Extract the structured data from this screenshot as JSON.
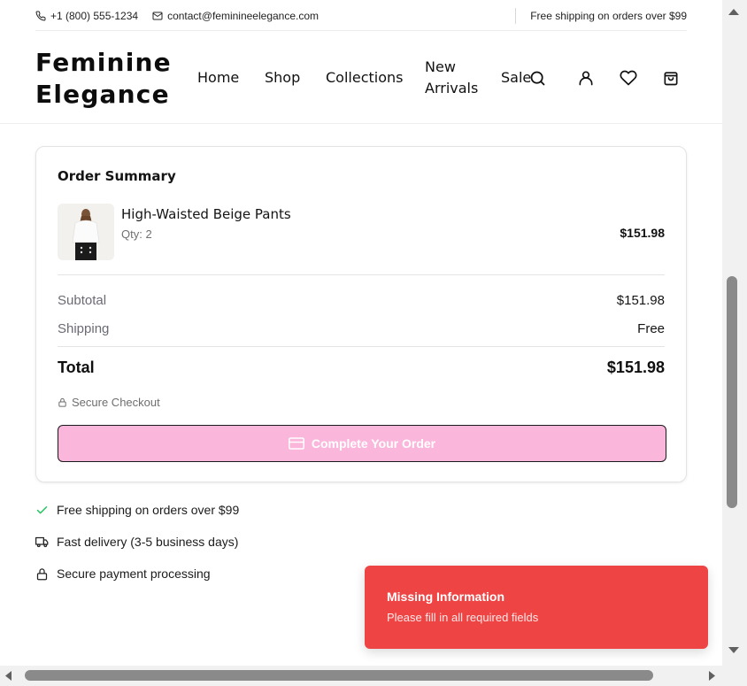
{
  "topbar": {
    "phone": "+1 (800) 555-1234",
    "email": "contact@feminineelegance.com",
    "promo": "Free shipping on orders over $99"
  },
  "header": {
    "logo_line1": "Feminine",
    "logo_line2": "Elegance",
    "nav": {
      "home": "Home",
      "shop": "Shop",
      "collections": "Collections",
      "new_arrivals_line1": "New",
      "new_arrivals_line2": "Arrivals",
      "sale": "Sale"
    },
    "icons": [
      "search-icon",
      "user-icon",
      "heart-icon",
      "shopping-bag-icon"
    ]
  },
  "summary": {
    "title": "Order Summary",
    "item": {
      "name": "High-Waisted Beige Pants",
      "qty": "Qty: 2",
      "price": "$151.98"
    },
    "subtotal_label": "Subtotal",
    "subtotal_value": "$151.98",
    "shipping_label": "Shipping",
    "shipping_value": "Free",
    "total_label": "Total",
    "total_value": "$151.98",
    "secure_label": "Secure Checkout",
    "button_label": "Complete Your Order"
  },
  "features": [
    "Free shipping on orders over $99",
    "Fast delivery (3-5 business days)",
    "Secure payment processing"
  ],
  "toast": {
    "title": "Missing Information",
    "message": "Please fill in all required fields"
  },
  "colors": {
    "button_bg": "#fbb6dc",
    "toast_bg": "#ef4444",
    "check_green": "#22c55e"
  }
}
